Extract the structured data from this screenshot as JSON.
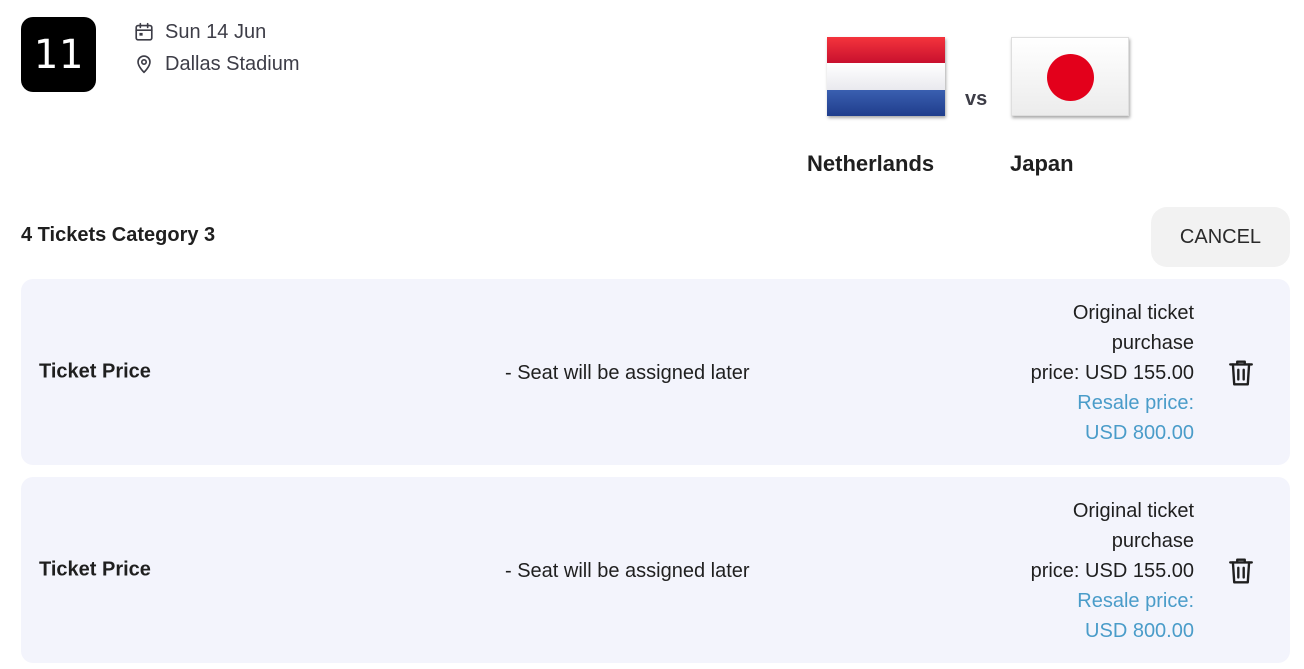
{
  "match": {
    "number": "11",
    "date": "Sun 14 Jun",
    "venue": "Dallas Stadium",
    "home_team": "Netherlands",
    "away_team": "Japan",
    "vs_label": "vs"
  },
  "order": {
    "title": "4 Tickets Category 3",
    "cancel_label": "CANCEL"
  },
  "tickets": [
    {
      "label": "Ticket Price",
      "seat": "- Seat will be assigned later",
      "original_line1": "Original ticket",
      "original_line2": "purchase",
      "original_line3": "price: USD 155.00",
      "resale_line1": "Resale price:",
      "resale_line2": "USD 800.00"
    },
    {
      "label": "Ticket Price",
      "seat": "- Seat will be assigned later",
      "original_line1": "Original ticket",
      "original_line2": "purchase",
      "original_line3": "price: USD 155.00",
      "resale_line1": "Resale price:",
      "resale_line2": "USD 800.00"
    }
  ],
  "icons": {
    "date": "calendar-icon",
    "venue": "location-pin-icon",
    "delete": "trash-icon"
  },
  "colors": {
    "card_background": "#f3f4fc",
    "resale_text": "#4a9cc9",
    "match_badge": "#000000"
  }
}
